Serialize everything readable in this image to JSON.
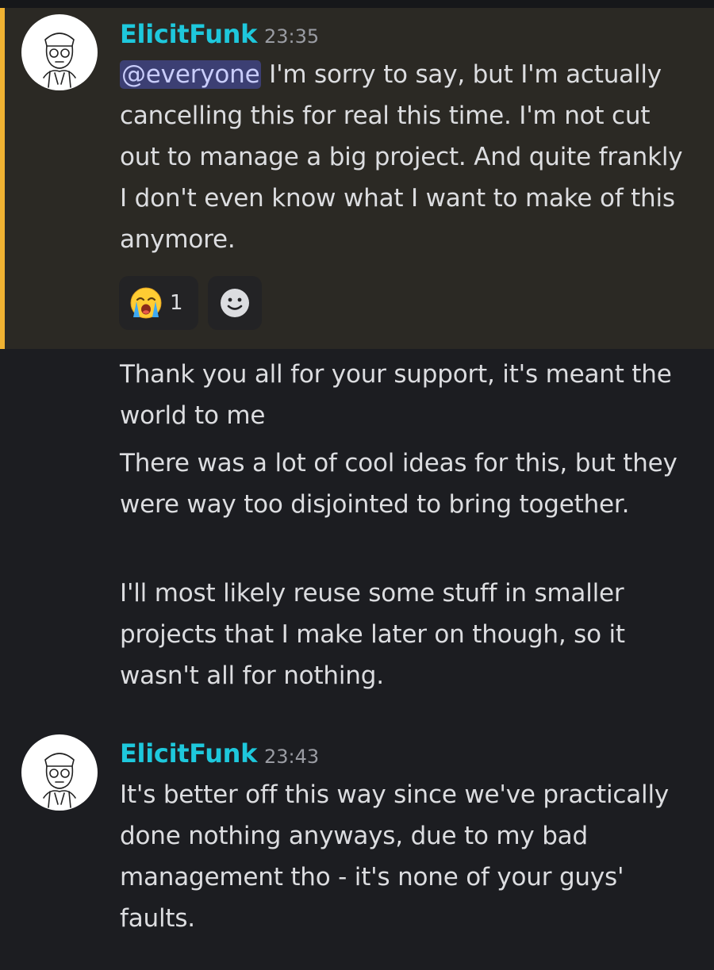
{
  "messages": [
    {
      "author": "ElicitFunk",
      "time": "23:35",
      "mention": "@everyone",
      "text": " I'm sorry to say, but I'm actually cancelling this for real this time. I'm not cut out to manage a big project. And quite frankly I don't even know what I want to make of this anymore.",
      "reactions": [
        {
          "icon": "loudly-crying-face-emoji",
          "count": "1"
        }
      ],
      "add_reaction_icon": "smiley-face-icon"
    },
    {
      "text": "Thank you all for your support, it's meant the world to me"
    },
    {
      "text": "There was a lot of cool ideas for this, but they were way too disjointed to bring together."
    },
    {
      "text": "I'll most likely reuse some stuff in smaller projects that I make later on though, so it wasn't all for nothing."
    },
    {
      "author": "ElicitFunk",
      "time": "23:43",
      "text": "It's better off this way since we've practically done nothing anyways, due to my bad management tho - it's none of your guys' faults."
    }
  ],
  "colors": {
    "background": "#1c1d21",
    "highlight_background": "#2b2924",
    "highlight_bar": "#f0b232",
    "username": "#1ec8dc",
    "mention_background": "#3c3f73",
    "text": "#dcdde0",
    "timestamp": "#9a9ca3"
  }
}
